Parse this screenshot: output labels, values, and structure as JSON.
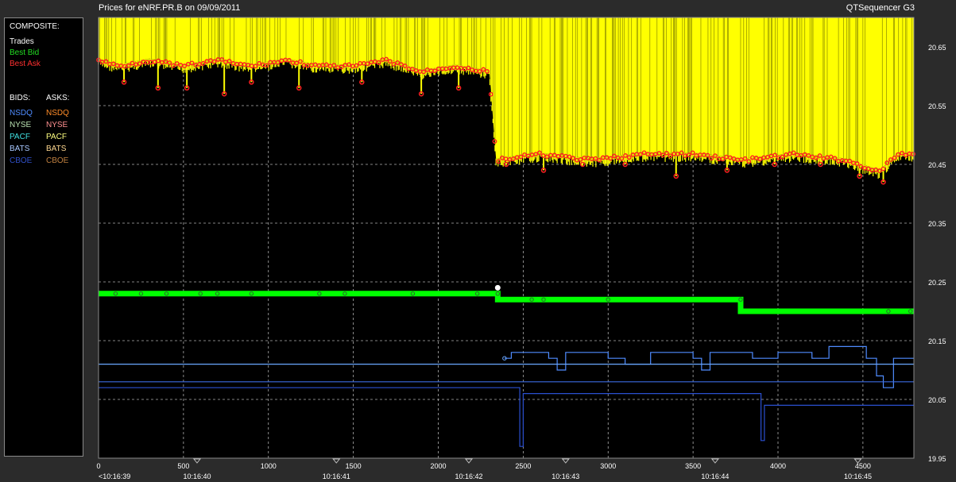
{
  "header": {
    "title": "Prices for  eNRF.PR.B  on  09/09/2011",
    "app_name": "QTSequencer G3"
  },
  "legend": {
    "composite_title": "COMPOSITE:",
    "composite_items": [
      {
        "label": "Trades",
        "color": "#ffffff"
      },
      {
        "label": "Best Bid",
        "color": "#22dd22"
      },
      {
        "label": "Best Ask",
        "color": "#ff3030"
      }
    ],
    "bids_title": "BIDS:",
    "asks_title": "ASKS:",
    "bids": [
      {
        "label": "NSDQ",
        "color": "#4f8cff"
      },
      {
        "label": "NYSE",
        "color": "#b8e0b0"
      },
      {
        "label": "PACF",
        "color": "#40e0e0"
      },
      {
        "label": "BATS",
        "color": "#a8c8ff"
      },
      {
        "label": "CBOE",
        "color": "#3050c8"
      }
    ],
    "asks": [
      {
        "label": "NSDQ",
        "color": "#ff8c28"
      },
      {
        "label": "NYSE",
        "color": "#ff9090"
      },
      {
        "label": "PACF",
        "color": "#ffff80"
      },
      {
        "label": "BATS",
        "color": "#ffd890"
      },
      {
        "label": "CBOE",
        "color": "#c08040"
      }
    ]
  },
  "colors": {
    "plot_bg": "#000000",
    "ask_fill": "#ffff00",
    "ask_dots": "#ff2020",
    "bid_line": "#00ff00",
    "trades": "#ffffff",
    "exchange_bid": "#4f8cff",
    "exchange_bid2": "#2a4fd0",
    "grid": "#b0b0b0"
  },
  "chart_data": {
    "type": "line",
    "title": "Prices for  eNRF.PR.B  on  09/09/2011",
    "x_range": [
      0,
      4800
    ],
    "y_range": [
      19.95,
      20.7
    ],
    "y_ticks": [
      "20.65",
      "20.55",
      "20.45",
      "20.35",
      "20.25",
      "20.15",
      "20.05",
      "19.95"
    ],
    "y_tick_values": [
      20.65,
      20.55,
      20.45,
      20.35,
      20.25,
      20.15,
      20.05,
      19.95
    ],
    "x_ticks": [
      "0",
      "500",
      "1000",
      "1500",
      "2000",
      "2500",
      "3000",
      "3500",
      "4000",
      "4500"
    ],
    "x_tick_values": [
      0,
      500,
      1000,
      1500,
      2000,
      2500,
      3000,
      3500,
      4000,
      4500
    ],
    "time_labels": [
      "<10:16:39",
      "10:16:40",
      "10:16:41",
      "10:16:42",
      "10:16:43",
      "10:16:44",
      "10:16:45"
    ],
    "time_values": [
      0,
      580,
      1400,
      2180,
      2750,
      3630,
      4470
    ],
    "grid": true,
    "series": [
      {
        "name": "Best Ask",
        "points": [
          [
            0,
            20.63
          ],
          [
            120,
            20.62
          ],
          [
            300,
            20.63
          ],
          [
            500,
            20.62
          ],
          [
            700,
            20.63
          ],
          [
            900,
            20.62
          ],
          [
            1100,
            20.63
          ],
          [
            1300,
            20.62
          ],
          [
            1500,
            20.62
          ],
          [
            1700,
            20.63
          ],
          [
            1900,
            20.61
          ],
          [
            2100,
            20.62
          ],
          [
            2300,
            20.61
          ],
          [
            2340,
            20.46
          ],
          [
            2600,
            20.47
          ],
          [
            2900,
            20.46
          ],
          [
            3200,
            20.47
          ],
          [
            3500,
            20.47
          ],
          [
            3800,
            20.46
          ],
          [
            4100,
            20.47
          ],
          [
            4400,
            20.46
          ],
          [
            4600,
            20.44
          ],
          [
            4700,
            20.47
          ],
          [
            4800,
            20.47
          ]
        ],
        "dips": [
          [
            150,
            20.59
          ],
          [
            350,
            20.58
          ],
          [
            520,
            20.58
          ],
          [
            740,
            20.57
          ],
          [
            900,
            20.59
          ],
          [
            1180,
            20.58
          ],
          [
            1550,
            20.59
          ],
          [
            1900,
            20.57
          ],
          [
            2120,
            20.58
          ],
          [
            2400,
            20.45
          ],
          [
            2620,
            20.44
          ],
          [
            2850,
            20.45
          ],
          [
            3100,
            20.45
          ],
          [
            3400,
            20.43
          ],
          [
            3700,
            20.44
          ],
          [
            3980,
            20.45
          ],
          [
            4250,
            20.45
          ],
          [
            4480,
            20.43
          ],
          [
            4620,
            20.42
          ]
        ]
      },
      {
        "name": "Best Bid",
        "points": [
          [
            0,
            20.23
          ],
          [
            2350,
            20.23
          ],
          [
            2350,
            20.22
          ],
          [
            3780,
            20.22
          ],
          [
            3780,
            20.2
          ],
          [
            4800,
            20.2
          ]
        ]
      },
      {
        "name": "Trades",
        "points": [
          [
            2350,
            20.24
          ]
        ]
      },
      {
        "name": "NSDQ",
        "points": [
          [
            2390,
            20.12
          ],
          [
            2430,
            20.13
          ],
          [
            2650,
            20.12
          ],
          [
            2700,
            20.1
          ],
          [
            2750,
            20.13
          ],
          [
            3000,
            20.12
          ],
          [
            3100,
            20.11
          ],
          [
            3250,
            20.13
          ],
          [
            3500,
            20.12
          ],
          [
            3550,
            20.1
          ],
          [
            3600,
            20.13
          ],
          [
            3850,
            20.12
          ],
          [
            4000,
            20.13
          ],
          [
            4200,
            20.12
          ],
          [
            4300,
            20.14
          ],
          [
            4450,
            20.14
          ],
          [
            4520,
            20.12
          ],
          [
            4580,
            20.09
          ],
          [
            4620,
            20.07
          ],
          [
            4680,
            20.12
          ],
          [
            4800,
            20.12
          ]
        ]
      },
      {
        "name": "BATS",
        "points": [
          [
            0,
            20.11
          ],
          [
            4800,
            20.11
          ]
        ]
      },
      {
        "name": "CBOE",
        "points": [
          [
            0,
            20.08
          ],
          [
            4800,
            20.08
          ]
        ]
      },
      {
        "name": "NSDQ",
        "points": [
          [
            0,
            20.07
          ],
          [
            2480,
            20.07
          ],
          [
            2480,
            19.97
          ],
          [
            2500,
            20.06
          ],
          [
            3900,
            20.06
          ],
          [
            3900,
            19.98
          ],
          [
            3920,
            20.04
          ],
          [
            4800,
            20.04
          ]
        ]
      }
    ]
  }
}
